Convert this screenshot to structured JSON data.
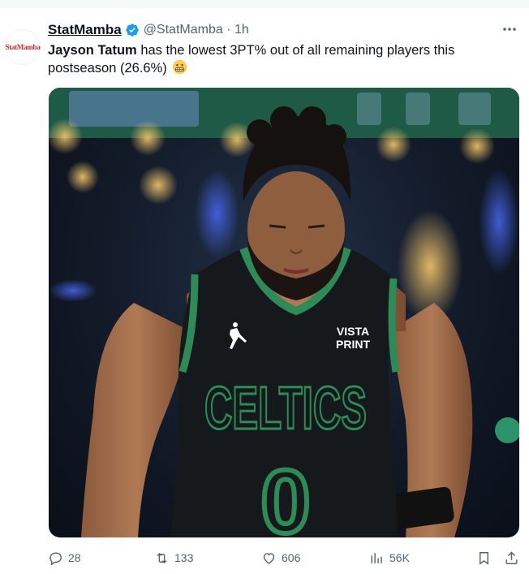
{
  "tweet": {
    "avatar": {
      "text": "StatMamba"
    },
    "author": {
      "display_name": "StatMamba",
      "handle_time": "@StatMamba · 1h"
    },
    "text": {
      "bold": "Jayson Tatum",
      "rest": " has the lowest 3PT% out of all remaining players this postseason (26.6%) "
    },
    "emoji_icon": "grimacing-face-emoji",
    "image": {
      "jersey_team": "CELTICS",
      "jersey_number": "0",
      "sponsor_line1": "VISTA",
      "sponsor_line2": "PRINT"
    },
    "actions": {
      "replies": "28",
      "reposts": "133",
      "likes": "606",
      "views": "56K"
    }
  },
  "colors": {
    "accent": "#1d9bf0",
    "celtics_green": "#2e8b57",
    "secondary_text": "#536471"
  }
}
